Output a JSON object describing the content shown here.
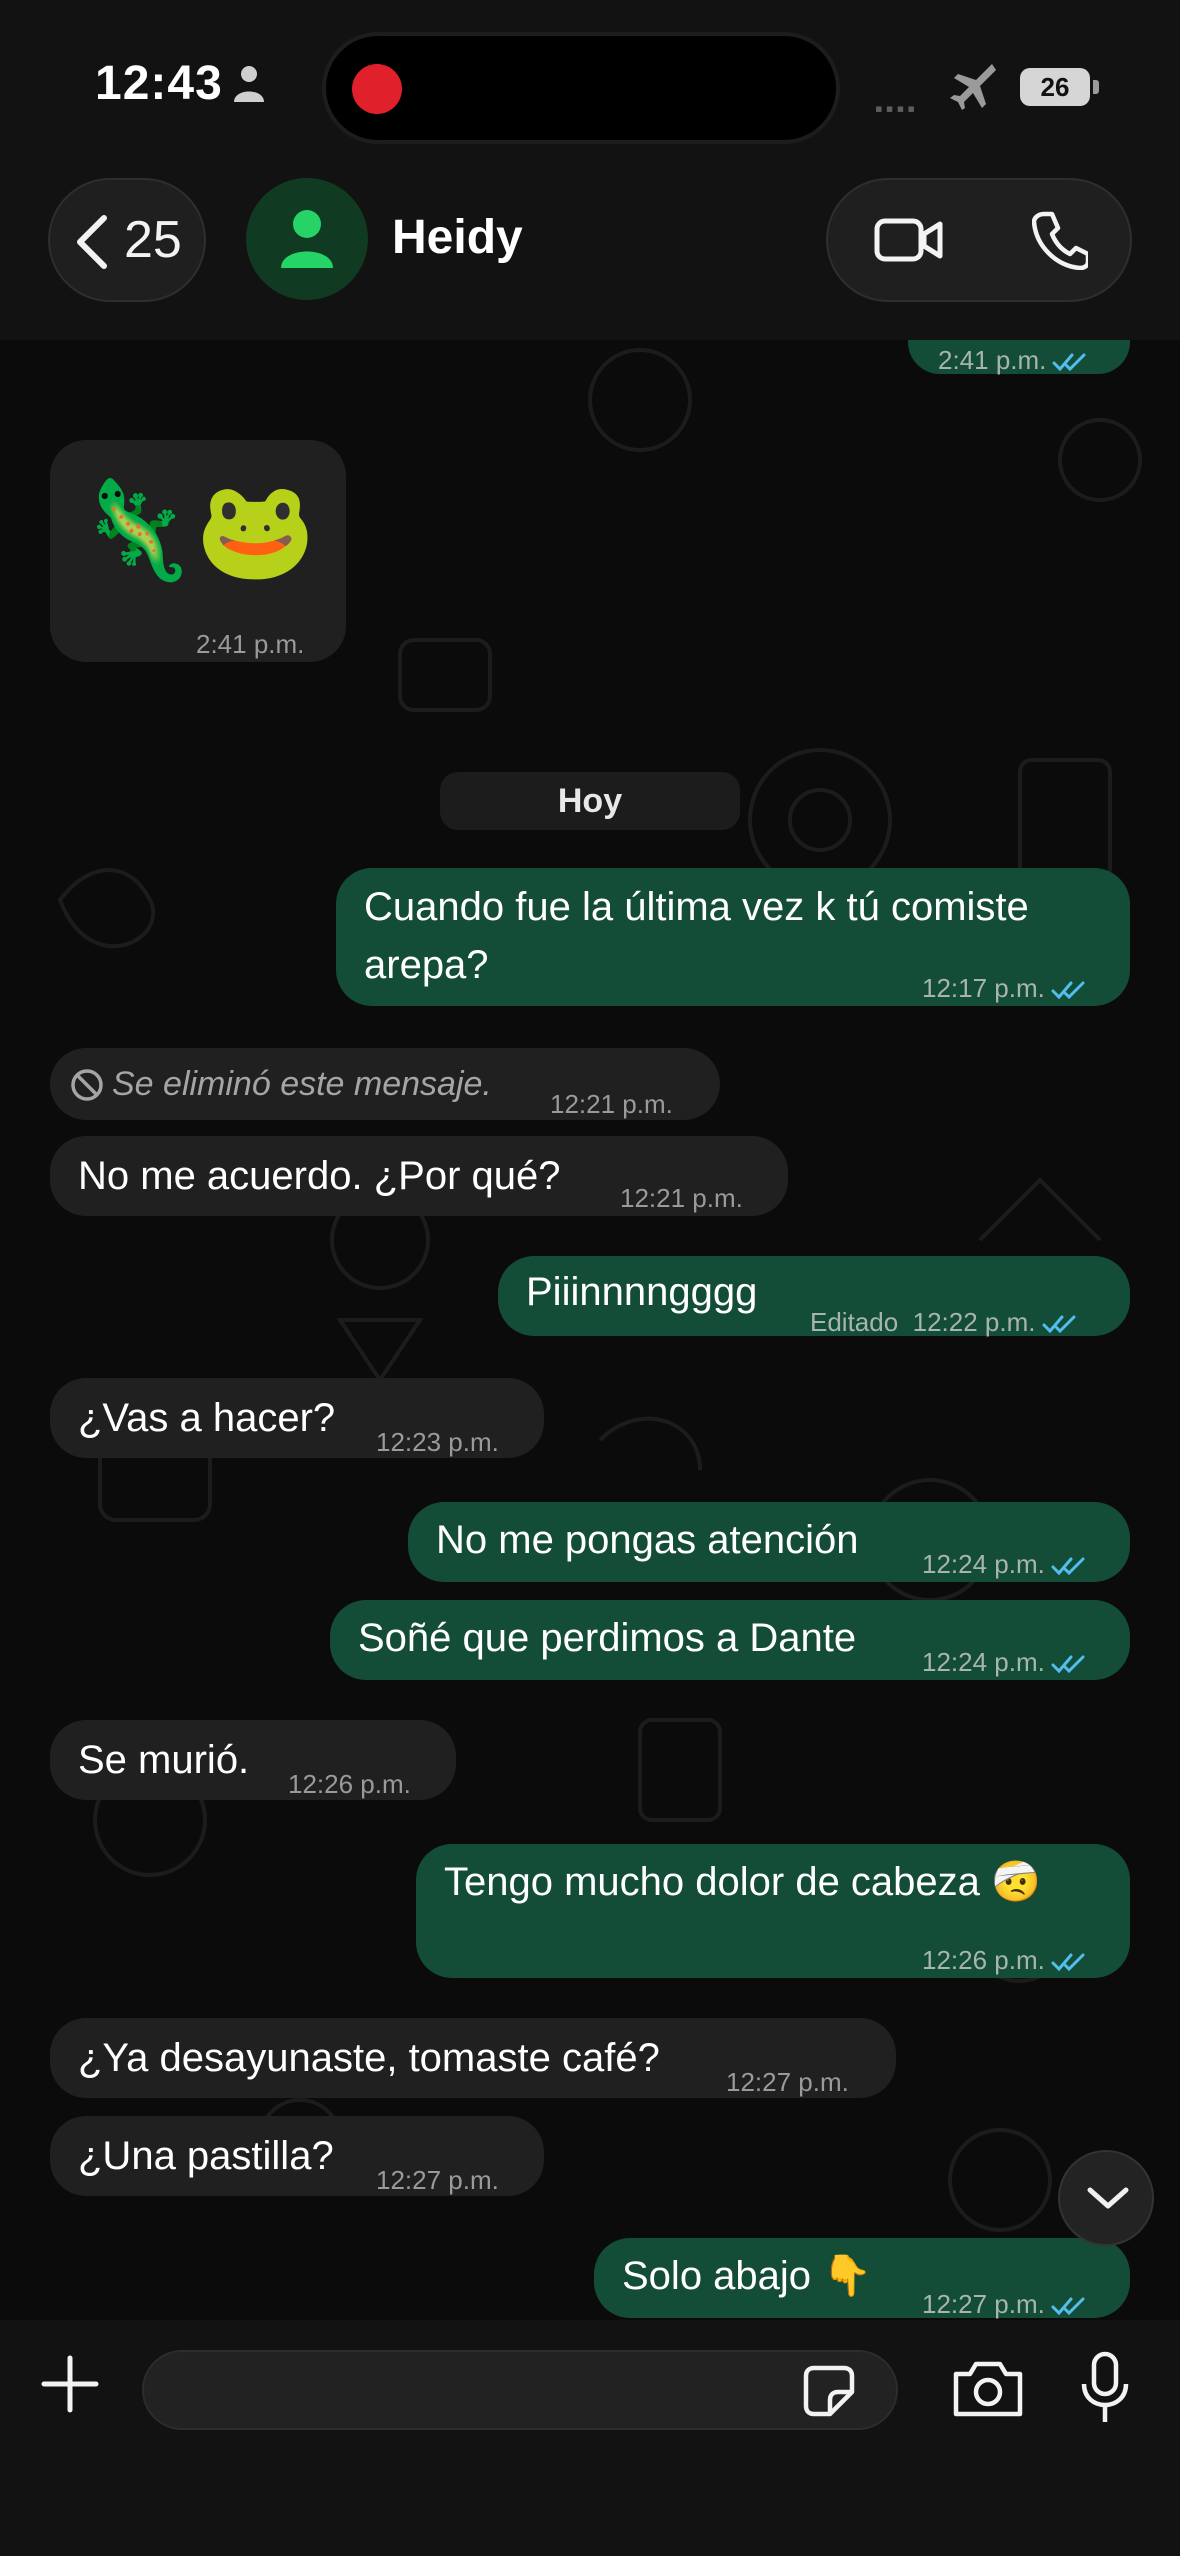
{
  "status_bar": {
    "time": "12:43",
    "battery": "26"
  },
  "header": {
    "back_count": "25",
    "contact_name": "Heidy"
  },
  "colors": {
    "incoming_bubble": "#202020",
    "outgoing_bubble": "#134d37",
    "read_ticks": "#53bdeb",
    "avatar_accent": "#25d366"
  },
  "messages": [
    {
      "id": "m0",
      "direction": "out",
      "text": "",
      "time": "2:41 p.m.",
      "read": true
    },
    {
      "id": "m1",
      "direction": "in",
      "text": "🦎🐸",
      "time": "2:41 p.m."
    },
    {
      "id": "m2",
      "direction": "out",
      "text": "Cuando fue la última vez k tú comiste arepa?",
      "time": "12:17 p.m.",
      "read": true
    },
    {
      "id": "m3",
      "direction": "in",
      "text": "Se eliminó este mensaje.",
      "time": "12:21 p.m.",
      "deleted": true
    },
    {
      "id": "m4",
      "direction": "in",
      "text": "No me acuerdo. ¿Por qué?",
      "time": "12:21 p.m."
    },
    {
      "id": "m5",
      "direction": "out",
      "text": "Piiinnnngggg",
      "edited_label": "Editado",
      "time": "12:22 p.m.",
      "read": true
    },
    {
      "id": "m6",
      "direction": "in",
      "text": "¿Vas a hacer?",
      "time": "12:23 p.m."
    },
    {
      "id": "m7",
      "direction": "out",
      "text": "No me pongas atención",
      "time": "12:24 p.m.",
      "read": true
    },
    {
      "id": "m8",
      "direction": "out",
      "text": "Soñé que perdimos a Dante",
      "time": "12:24 p.m.",
      "read": true
    },
    {
      "id": "m9",
      "direction": "in",
      "text": "Se murió.",
      "time": "12:26 p.m."
    },
    {
      "id": "m10",
      "direction": "out",
      "text": "Tengo mucho dolor de cabeza 🤕",
      "time": "12:26 p.m.",
      "read": true
    },
    {
      "id": "m11",
      "direction": "in",
      "text": "¿Ya desayunaste, tomaste café?",
      "time": "12:27 p.m."
    },
    {
      "id": "m12",
      "direction": "in",
      "text": "¿Una pastilla?",
      "time": "12:27 p.m."
    },
    {
      "id": "m13",
      "direction": "out",
      "text": "Solo abajo 👇",
      "time": "12:27 p.m.",
      "read": true
    }
  ],
  "date_separator": "Hoy",
  "composer": {
    "value": "",
    "placeholder": ""
  },
  "icons": [
    "person-icon",
    "airplane-mode-icon",
    "battery-icon",
    "chevron-left-icon",
    "avatar-person-icon",
    "video-camera-icon",
    "phone-icon",
    "double-check-icon",
    "deleted-icon",
    "chevron-down-icon",
    "plus-icon",
    "sticker-icon",
    "camera-icon",
    "microphone-icon"
  ]
}
